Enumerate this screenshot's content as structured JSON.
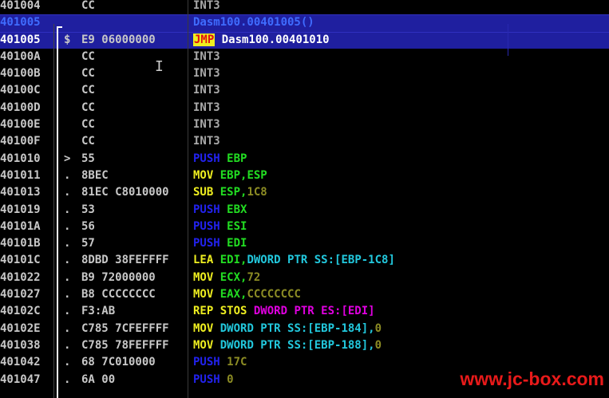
{
  "rows": [
    {
      "addr": "401004",
      "mark": "",
      "hex": "CC",
      "dis": [
        {
          "t": "INT3",
          "c": "c-int"
        }
      ]
    },
    {
      "addr": "401005",
      "mark": "",
      "hex": "",
      "dis": [
        {
          "t": "Dasm100.00401005()",
          "c": "c-lbl"
        }
      ],
      "selected": true,
      "label": true
    },
    {
      "addr": "401005",
      "mark": "$",
      "hex": "E9 06000000",
      "dis": [
        {
          "t": "JMP",
          "c": "jmp"
        },
        {
          "t": " Dasm100.00401010",
          "c": "c-txt"
        }
      ],
      "selected": true,
      "current": true
    },
    {
      "addr": "40100A",
      "mark": "",
      "hex": "CC",
      "dis": [
        {
          "t": "INT3",
          "c": "c-int"
        }
      ]
    },
    {
      "addr": "40100B",
      "mark": "",
      "hex": "CC",
      "dis": [
        {
          "t": "INT3",
          "c": "c-int"
        }
      ]
    },
    {
      "addr": "40100C",
      "mark": "",
      "hex": "CC",
      "dis": [
        {
          "t": "INT3",
          "c": "c-int"
        }
      ]
    },
    {
      "addr": "40100D",
      "mark": "",
      "hex": "CC",
      "dis": [
        {
          "t": "INT3",
          "c": "c-int"
        }
      ]
    },
    {
      "addr": "40100E",
      "mark": "",
      "hex": "CC",
      "dis": [
        {
          "t": "INT3",
          "c": "c-int"
        }
      ]
    },
    {
      "addr": "40100F",
      "mark": "",
      "hex": "CC",
      "dis": [
        {
          "t": "INT3",
          "c": "c-int"
        }
      ]
    },
    {
      "addr": "401010",
      "mark": ">",
      "hex": "55",
      "dis": [
        {
          "t": "PUSH",
          "c": "c-push"
        },
        {
          "t": " EBP",
          "c": "c-reg"
        }
      ]
    },
    {
      "addr": "401011",
      "mark": ".",
      "hex": "8BEC",
      "dis": [
        {
          "t": "MOV",
          "c": "c-mov"
        },
        {
          "t": " EBP,ESP",
          "c": "c-reg"
        }
      ]
    },
    {
      "addr": "401013",
      "mark": ".",
      "hex": "81EC C8010000",
      "dis": [
        {
          "t": "SUB",
          "c": "c-mov"
        },
        {
          "t": " ESP,",
          "c": "c-reg"
        },
        {
          "t": "1C8",
          "c": "c-imm"
        }
      ]
    },
    {
      "addr": "401019",
      "mark": ".",
      "hex": "53",
      "dis": [
        {
          "t": "PUSH",
          "c": "c-push"
        },
        {
          "t": " EBX",
          "c": "c-reg"
        }
      ]
    },
    {
      "addr": "40101A",
      "mark": ".",
      "hex": "56",
      "dis": [
        {
          "t": "PUSH",
          "c": "c-push"
        },
        {
          "t": " ESI",
          "c": "c-reg"
        }
      ]
    },
    {
      "addr": "40101B",
      "mark": ".",
      "hex": "57",
      "dis": [
        {
          "t": "PUSH",
          "c": "c-push"
        },
        {
          "t": " EDI",
          "c": "c-reg"
        }
      ]
    },
    {
      "addr": "40101C",
      "mark": ".",
      "hex": "8DBD 38FEFFFF",
      "dis": [
        {
          "t": "LEA",
          "c": "c-lea"
        },
        {
          "t": " EDI,",
          "c": "c-reg"
        },
        {
          "t": "DWORD PTR SS:[EBP-1C8]",
          "c": "c-mem"
        }
      ]
    },
    {
      "addr": "401022",
      "mark": ".",
      "hex": "B9 72000000",
      "dis": [
        {
          "t": "MOV",
          "c": "c-mov"
        },
        {
          "t": " ECX,",
          "c": "c-reg"
        },
        {
          "t": "72",
          "c": "c-imm"
        }
      ]
    },
    {
      "addr": "401027",
      "mark": ".",
      "hex": "B8 CCCCCCCC",
      "dis": [
        {
          "t": "MOV",
          "c": "c-mov"
        },
        {
          "t": " EAX,",
          "c": "c-reg"
        },
        {
          "t": "CCCCCCCC",
          "c": "c-imm"
        }
      ]
    },
    {
      "addr": "40102C",
      "mark": ".",
      "hex": "F3:AB",
      "dis": [
        {
          "t": "REP STOS",
          "c": "c-rep"
        },
        {
          "t": " DWORD PTR ES:[EDI]",
          "c": "c-stos"
        }
      ]
    },
    {
      "addr": "40102E",
      "mark": ".",
      "hex": "C785 7CFEFFFF",
      "dis": [
        {
          "t": "MOV",
          "c": "c-mov"
        },
        {
          "t": " DWORD PTR SS:[EBP-184],",
          "c": "c-mem"
        },
        {
          "t": "0",
          "c": "c-imm"
        }
      ]
    },
    {
      "addr": "401038",
      "mark": ".",
      "hex": "C785 78FEFFFF",
      "dis": [
        {
          "t": "MOV",
          "c": "c-mov"
        },
        {
          "t": " DWORD PTR SS:[EBP-188],",
          "c": "c-mem"
        },
        {
          "t": "0",
          "c": "c-imm"
        }
      ]
    },
    {
      "addr": "401042",
      "mark": ".",
      "hex": "68 7C010000",
      "dis": [
        {
          "t": "PUSH",
          "c": "c-push"
        },
        {
          "t": " 17C",
          "c": "c-imm"
        }
      ]
    },
    {
      "addr": "401047",
      "mark": ".",
      "hex": "6A 00",
      "dis": [
        {
          "t": "PUSH",
          "c": "c-push"
        },
        {
          "t": " 0",
          "c": "c-imm"
        }
      ]
    }
  ],
  "watermark": "www.jc-box.com",
  "colors": {
    "background": "#000000",
    "selection": "#1f1f9f",
    "jmp_box": "#eeee20",
    "jmp_text": "#e01010",
    "register": "#22dd22",
    "push": "#2222ee",
    "memory": "#22c8dd",
    "stos": "#e000e0",
    "watermark": "#e81a1a"
  }
}
